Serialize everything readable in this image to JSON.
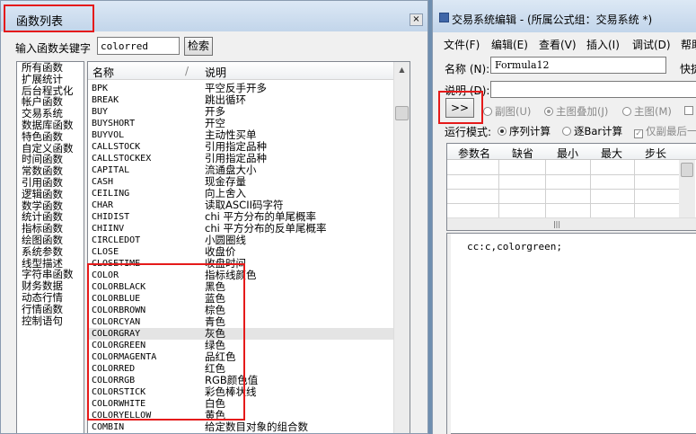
{
  "left_window": {
    "title": "函数列表",
    "close": "×",
    "search": {
      "label": "输入函数关键字",
      "value": "colorred",
      "button": "检索"
    }
  },
  "categories": [
    "所有函数",
    "扩展统计",
    "后台程式化",
    "帐户函数",
    "交易系统",
    "数据库函数",
    "特色函数",
    "自定义函数",
    "时间函数",
    "常数函数",
    "引用函数",
    "逻辑函数",
    "数学函数",
    "统计函数",
    "指标函数",
    "绘图函数",
    "系统参数",
    "线型描述",
    "字符串函数",
    "财务数据",
    "动态行情",
    "行情函数",
    "控制语句"
  ],
  "function_table": {
    "headers": {
      "name": "名称",
      "sep": "/",
      "desc": "说明"
    },
    "rows": [
      {
        "name": "BPK",
        "desc": "平空反手开多"
      },
      {
        "name": "BREAK",
        "desc": "跳出循环"
      },
      {
        "name": "BUY",
        "desc": "开多"
      },
      {
        "name": "BUYSHORT",
        "desc": "开空"
      },
      {
        "name": "BUYVOL",
        "desc": "主动性买单"
      },
      {
        "name": "CALLSTOCK",
        "desc": "引用指定品种"
      },
      {
        "name": "CALLSTOCKEX",
        "desc": "引用指定品种"
      },
      {
        "name": "CAPITAL",
        "desc": "流通盘大小"
      },
      {
        "name": "CASH",
        "desc": "现金存量"
      },
      {
        "name": "CEILING",
        "desc": "向上舍入"
      },
      {
        "name": "CHAR",
        "desc": "读取ASCII码字符"
      },
      {
        "name": "CHIDIST",
        "desc": "chi 平方分布的单尾概率"
      },
      {
        "name": "CHIINV",
        "desc": "chi 平方分布的反单尾概率"
      },
      {
        "name": "CIRCLEDOT",
        "desc": "小圆圈线"
      },
      {
        "name": "CLOSE",
        "desc": "收盘价"
      },
      {
        "name": "CLOSETIME",
        "desc": "收盘时间"
      },
      {
        "name": "COLOR",
        "desc": "指标线颜色"
      },
      {
        "name": "COLORBLACK",
        "desc": "黑色"
      },
      {
        "name": "COLORBLUE",
        "desc": "蓝色"
      },
      {
        "name": "COLORBROWN",
        "desc": "棕色"
      },
      {
        "name": "COLORCYAN",
        "desc": "青色"
      },
      {
        "name": "COLORGRAY",
        "desc": "灰色"
      },
      {
        "name": "COLORGREEN",
        "desc": "绿色"
      },
      {
        "name": "COLORMAGENTA",
        "desc": "品红色"
      },
      {
        "name": "COLORRED",
        "desc": "红色"
      },
      {
        "name": "COLORRGB",
        "desc": "RGB颜色值"
      },
      {
        "name": "COLORSTICK",
        "desc": "彩色棒状线"
      },
      {
        "name": "COLORWHITE",
        "desc": "白色"
      },
      {
        "name": "COLORYELLOW",
        "desc": "黄色"
      },
      {
        "name": "COMBIN",
        "desc": "给定数目对象的组合数"
      }
    ],
    "selected_index": 21
  },
  "right_window": {
    "title": "交易系统编辑 - (所属公式组：交易系统 *)",
    "menu": [
      "文件(F)",
      "编辑(E)",
      "查看(V)",
      "插入(I)",
      "调试(D)",
      "帮助"
    ],
    "name_label": "名称 (N):",
    "name_value": "Formula12",
    "shortcut_label": "快捷",
    "desc_label": "说明 (D):",
    "desc_value": "",
    "expand_button": ">>",
    "display_options": [
      "副图(U)",
      "主图叠加(J)",
      "主图(M)"
    ],
    "run_mode_label": "运行模式:",
    "run_modes": [
      "序列计算",
      "逐Bar计算"
    ],
    "only_last_label": "仅副最后一",
    "param_headers": [
      "参数名",
      "缺省",
      "最小",
      "最大",
      "步长"
    ],
    "code": "cc:c,colorgreen;"
  },
  "colors": {
    "highlight_red": "#e51a1a",
    "title_bar": "#c2d5ea",
    "selected_row": "#e4e4e4"
  }
}
